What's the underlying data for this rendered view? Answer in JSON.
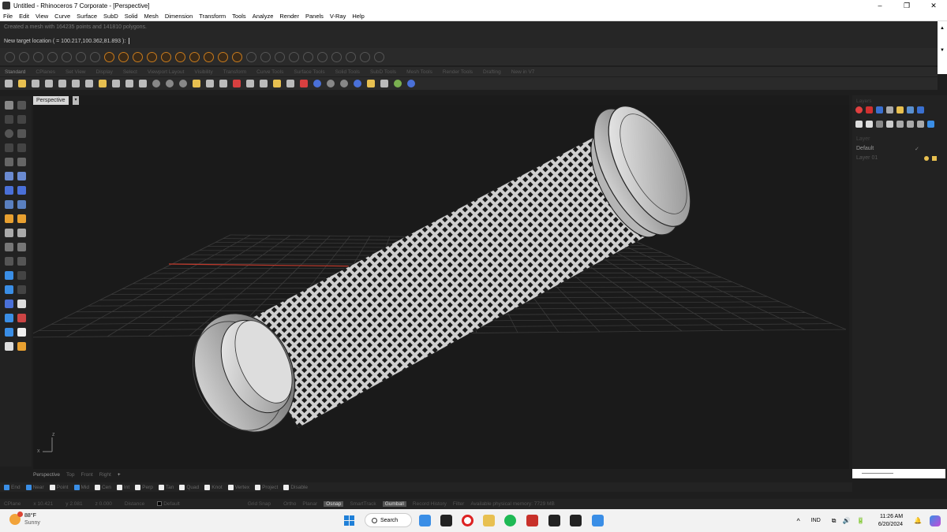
{
  "window": {
    "title": "Untitled - Rhinoceros 7 Corporate - [Perspective]",
    "controls": [
      "–",
      "❐",
      "✕"
    ]
  },
  "menu": [
    "File",
    "Edit",
    "View",
    "Curve",
    "Surface",
    "SubD",
    "Solid",
    "Mesh",
    "Dimension",
    "Transform",
    "Tools",
    "Analyze",
    "Render",
    "Panels",
    "V-Ray",
    "Help"
  ],
  "command": {
    "history": "Created a mesh with 164235 points and 141810 polygons.",
    "prompt": "New target location ( = 100.217,100.362,81.893 ):"
  },
  "toolbar_tabs": [
    "Standard",
    "CPlanes",
    "Set View",
    "Display",
    "Select",
    "Viewport Layout",
    "Visibility",
    "Transform",
    "Curve Tools",
    "Surface Tools",
    "Solid Tools",
    "SubD Tools",
    "Mesh Tools",
    "Render Tools",
    "Drafting",
    "New in V7"
  ],
  "viewport": {
    "label": "Perspective",
    "dropdown": "▾",
    "tabs": [
      "Perspective",
      "Top",
      "Front",
      "Right",
      "+"
    ],
    "axis_x": "x",
    "axis_z": "z"
  },
  "osnaps": [
    {
      "label": "End",
      "checked": true
    },
    {
      "label": "Near",
      "checked": true
    },
    {
      "label": "Point",
      "checked": false
    },
    {
      "label": "Mid",
      "checked": true
    },
    {
      "label": "Cen",
      "checked": false
    },
    {
      "label": "Int",
      "checked": false
    },
    {
      "label": "Perp",
      "checked": false
    },
    {
      "label": "Tan",
      "checked": false
    },
    {
      "label": "Quad",
      "checked": false
    },
    {
      "label": "Knot",
      "checked": false
    },
    {
      "label": "Vertex",
      "checked": false
    },
    {
      "label": "Project",
      "checked": false
    },
    {
      "label": "Disable",
      "checked": false
    }
  ],
  "status": {
    "cplane": "CPlane",
    "x": "x 10.421",
    "y": "y 2.081",
    "z": "z 0.000",
    "distance": "Distance",
    "layer": "Default",
    "grid_snap": "Grid Snap",
    "ortho": "Ortho",
    "planar": "Planar",
    "osnap": "Osnap",
    "smarttrack": "SmartTrack",
    "gumball": "Gumball",
    "record_history": "Record History",
    "filter": "Filter",
    "memory": "Available physical memory: 7729 MB"
  },
  "panel": {
    "header": "Layers",
    "sub": "Layer",
    "layers": [
      {
        "name": "Default",
        "check": "✓"
      },
      {
        "name": "Layer 01",
        "check": ""
      }
    ]
  },
  "taskbar": {
    "temp": "88°F",
    "weather": "Sunny",
    "search": "Search",
    "lang": "IND",
    "time": "11:26 AM",
    "date": "6/20/2024",
    "caret": "^",
    "sys_icons": "⧉ 🔊 🔋",
    "bell": "🔔"
  },
  "colors": {
    "accent": "#3a8ee6",
    "viewport_bg": "#1a1a1a",
    "x_axis": "#c0392b",
    "cylinder": "#d8d8d8"
  }
}
